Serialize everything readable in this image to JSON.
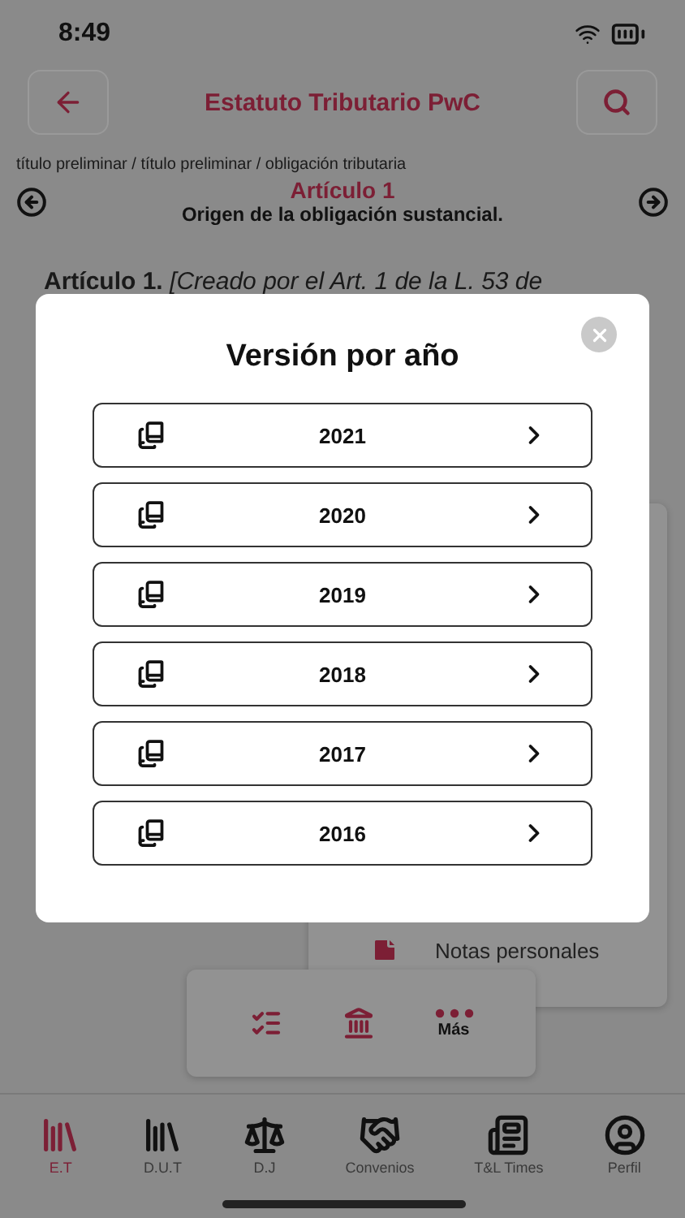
{
  "status_bar": {
    "time": "8:49"
  },
  "header": {
    "title": "Estatuto Tributario PwC"
  },
  "breadcrumb": "título preliminar / título preliminar / obligación tributaria",
  "article": {
    "number": "Artículo 1",
    "subtitle": "Origen de la obligación sustancial.",
    "body_start": "**Artículo 1.** *[Creado por el Art. 1 de la L. 53 de*"
  },
  "modal": {
    "title": "Versión por año",
    "years": [
      "2021",
      "2020",
      "2019",
      "2018",
      "2017",
      "2016"
    ]
  },
  "floating_menu": {
    "items": [
      {
        "label": "Notas personales"
      }
    ]
  },
  "action_bar": {
    "items": [
      {
        "kind": "checklist"
      },
      {
        "kind": "bank"
      },
      {
        "kind": "more",
        "label": "Más"
      }
    ]
  },
  "tab_bar": [
    {
      "label": "E.T",
      "selected": true
    },
    {
      "label": "D.U.T",
      "selected": false
    },
    {
      "label": "D.J",
      "selected": false
    },
    {
      "label": "Convenios",
      "selected": false
    },
    {
      "label": "T&L Times",
      "selected": false
    },
    {
      "label": "Perfil",
      "selected": false
    }
  ]
}
